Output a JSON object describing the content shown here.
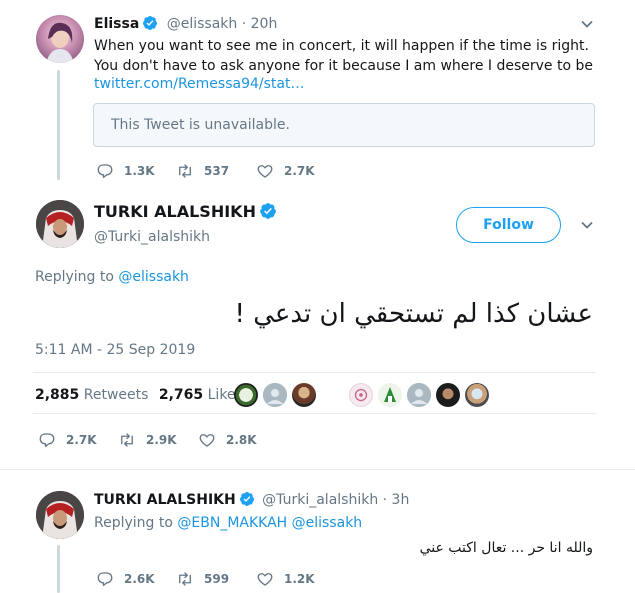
{
  "quoted_tweet": {
    "display_name": "Elissa",
    "handle": "@elissakh",
    "time": "· 20h",
    "text": "When you want to see me in concert, it will happen if the time is right. You don't have to ask anyone for it because I am where I deserve to be",
    "link": "twitter.com/Remessa94/stat…",
    "unavailable_notice": "This Tweet is unavailable.",
    "replies": "1.3K",
    "retweets": "537",
    "likes": "2.7K"
  },
  "main_tweet": {
    "display_name": "TURKI ALALSHIKH",
    "handle": "@Turki_alalshikh",
    "follow_label": "Follow",
    "replying_prefix": "Replying to",
    "replying_to": "@elissakh",
    "text": "عشان كذا لم تستحقي ان تدعي !",
    "timestamp": "5:11 AM - 25 Sep 2019",
    "retweet_count": "2,885",
    "retweet_label": "Retweets",
    "like_count": "2,765",
    "like_label": "Likes",
    "replies": "2.7K",
    "retweets": "2.9K",
    "likes": "2.8K"
  },
  "reply_tweet": {
    "display_name": "TURKI ALALSHIKH",
    "handle": "@Turki_alalshikh",
    "time": "· 3h",
    "replying_prefix": "Replying to",
    "replying_to": "@EBN_MAKKAH @elissakh",
    "text": "والله انا حر ... تعال اكتب عني",
    "replies": "2.6K",
    "retweets": "599",
    "likes": "1.2K"
  },
  "colors": {
    "accent": "#1da1f2",
    "link": "#1b95e0",
    "muted": "#657786",
    "divider": "#e6ecf0"
  },
  "icons": [
    "verified-badge-icon",
    "caret-down-icon",
    "reply-icon",
    "retweet-icon",
    "like-icon"
  ]
}
